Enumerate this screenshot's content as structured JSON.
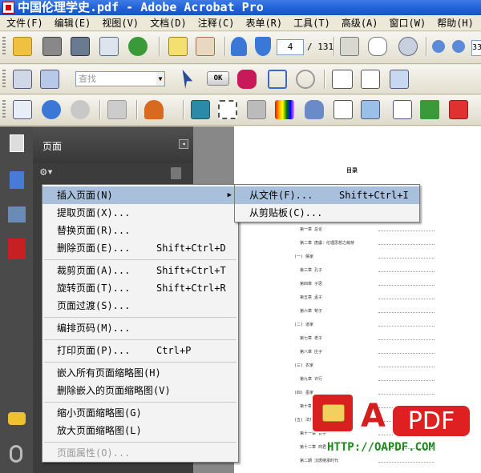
{
  "window": {
    "title": "中国伦理学史.pdf - Adobe Acrobat Pro"
  },
  "menubar": [
    "文件(F)",
    "编辑(E)",
    "视图(V)",
    "文档(D)",
    "注释(C)",
    "表单(R)",
    "工具(T)",
    "高级(A)",
    "窗口(W)",
    "帮助(H)"
  ],
  "toolbar": {
    "page_current": "4",
    "page_total": "/ 131",
    "find_placeholder": "查找",
    "ok_label": "OK",
    "zoom_partial": "33"
  },
  "panel": {
    "title": "页面"
  },
  "context_menu": {
    "items": [
      {
        "label": "插入页面(N)",
        "shortcut": "",
        "submenu": true,
        "highlighted": true,
        "disabled": false
      },
      {
        "label": "提取页面(X)...",
        "shortcut": ""
      },
      {
        "label": "替换页面(R)...",
        "shortcut": ""
      },
      {
        "label": "删除页面(E)...",
        "shortcut": "Shift+Ctrl+D"
      },
      {
        "label": "裁剪页面(A)...",
        "shortcut": "Shift+Ctrl+T"
      },
      {
        "label": "旋转页面(T)...",
        "shortcut": "Shift+Ctrl+R"
      },
      {
        "label": "页面过渡(S)...",
        "shortcut": ""
      },
      {
        "label": "编排页码(M)...",
        "shortcut": ""
      },
      {
        "label": "打印页面(P)...",
        "shortcut": "Ctrl+P"
      },
      {
        "label": "嵌入所有页面缩略图(H)",
        "shortcut": ""
      },
      {
        "label": "删除嵌入的页面缩略图(V)",
        "shortcut": ""
      },
      {
        "label": "缩小页面缩略图(G)",
        "shortcut": ""
      },
      {
        "label": "放大页面缩略图(L)",
        "shortcut": ""
      },
      {
        "label": "页面属性(O)...",
        "shortcut": "",
        "disabled": true
      }
    ],
    "submenu": [
      {
        "label": "从文件(F)...",
        "shortcut": "Shift+Ctrl+I",
        "highlighted": true
      },
      {
        "label": "从剪贴板(C)...",
        "shortcut": ""
      }
    ]
  },
  "document": {
    "toc_title": "目录",
    "toc_lines": [
      "第一章 总论",
      "第二章 唐虞：伦理思想之萌芽",
      "(一) 儒家",
      "第三章 孔子",
      "第四章 子思",
      "第五章 孟子",
      "第六章 荀子",
      "(二) 道家",
      "第七章 老子",
      "第八章 庄子",
      "(三) 农家",
      "第九章 许行",
      "(四) 墨家",
      "第十章 墨子",
      "(五) 法家",
      "第十一章 管子",
      "第十二章 商君",
      "第二期 汉唐继承时代"
    ]
  },
  "watermark": {
    "brand": "PDF",
    "letter": "A",
    "url": "HTTP://OAPDF.COM"
  },
  "colors": {
    "titlebar": "#1f5fd4",
    "menu_highlight": "#a8c0dc",
    "panel_bg": "#3c3c3c",
    "watermark_red": "#e02020",
    "url_green": "#1a8a1a"
  }
}
